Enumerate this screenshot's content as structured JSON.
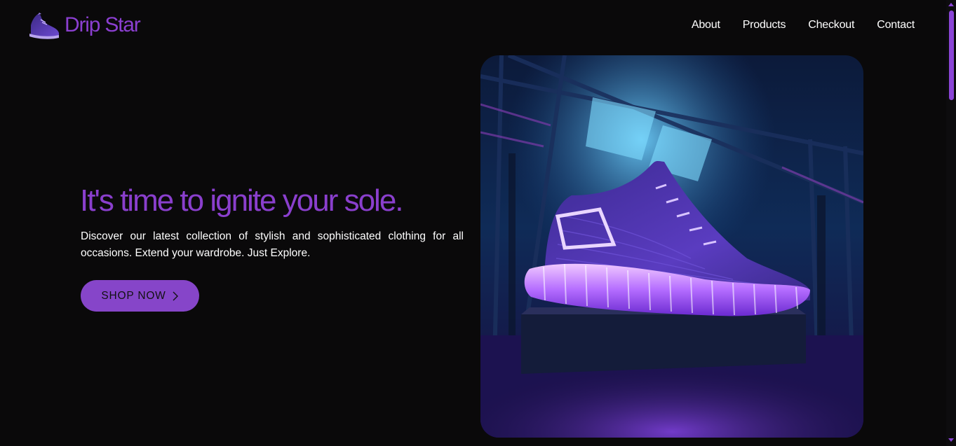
{
  "brand": {
    "name": "Drip Star",
    "logo_icon": "sneaker-logo-icon",
    "color": "#8b3fd0"
  },
  "nav": {
    "items": [
      {
        "label": "About"
      },
      {
        "label": "Products"
      },
      {
        "label": "Checkout"
      },
      {
        "label": "Contact"
      }
    ]
  },
  "hero": {
    "title": "It's time to ignite your sole.",
    "description": "Discover our latest collection of stylish and sophisticated clothing for all occasions. Extend your wardrobe. Just Explore.",
    "cta_label": "SHOP NOW",
    "cta_icon": "chevron-right-icon",
    "image_subject": "glowing-purple-sneaker-image"
  },
  "colors": {
    "accent": "#8a3fcd",
    "button": "#8645c9",
    "background": "#0a090a"
  }
}
